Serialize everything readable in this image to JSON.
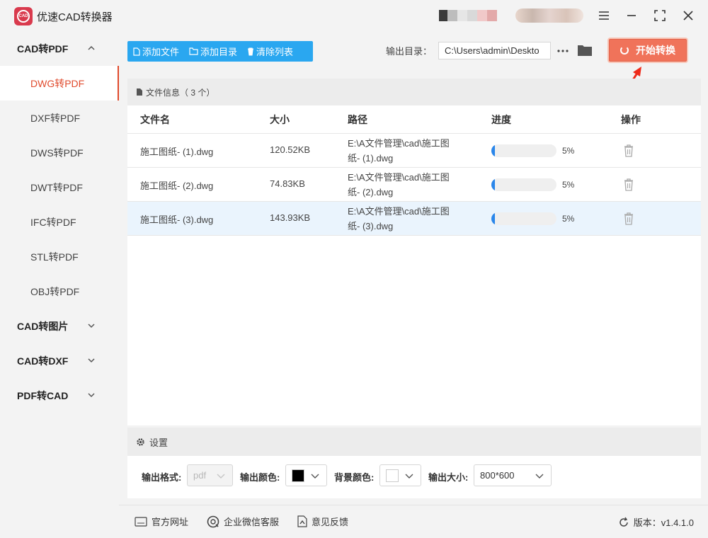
{
  "app": {
    "title": "优速CAD转换器",
    "logo_text": "CAD"
  },
  "sidebar": {
    "groups": [
      {
        "label": "CAD转PDF",
        "expanded": true,
        "items": [
          "DWG转PDF",
          "DXF转PDF",
          "DWS转PDF",
          "DWT转PDF",
          "IFC转PDF",
          "STL转PDF",
          "OBJ转PDF"
        ],
        "active_item": "DWG转PDF"
      },
      {
        "label": "CAD转图片",
        "expanded": false
      },
      {
        "label": "CAD转DXF",
        "expanded": false
      },
      {
        "label": "PDF转CAD",
        "expanded": false
      }
    ]
  },
  "toolbar": {
    "add_file": "添加文件",
    "add_dir": "添加目录",
    "clear_list": "清除列表",
    "output_label": "输出目录：",
    "output_path": "C:\\Users\\admin\\Deskto",
    "start": "开始转换"
  },
  "file_panel": {
    "header": "文件信息（ 3 个）",
    "columns": {
      "name": "文件名",
      "size": "大小",
      "path": "路径",
      "progress": "进度",
      "action": "操作"
    },
    "rows": [
      {
        "name": "施工图纸- (1).dwg",
        "size": "120.52KB",
        "path_line1": "E:\\A文件管理\\cad\\施工图",
        "path_line2": "纸- (1).dwg",
        "progress": 0.05,
        "progress_text": "5%"
      },
      {
        "name": "施工图纸- (2).dwg",
        "size": "74.83KB",
        "path_line1": "E:\\A文件管理\\cad\\施工图",
        "path_line2": "纸- (2).dwg",
        "progress": 0.05,
        "progress_text": "5%"
      },
      {
        "name": "施工图纸- (3).dwg",
        "size": "143.93KB",
        "path_line1": "E:\\A文件管理\\cad\\施工图",
        "path_line2": "纸- (3).dwg",
        "progress": 0.05,
        "progress_text": "5%",
        "selected": true
      }
    ]
  },
  "settings": {
    "header": "设置",
    "format_label": "输出格式:",
    "format_value": "pdf",
    "color_label": "输出颜色:",
    "color_value": "#000000",
    "bg_label": "背景颜色:",
    "bg_value": "#ffffff",
    "size_label": "输出大小:",
    "size_value": "800*600"
  },
  "footer": {
    "website": "官方网址",
    "wechat": "企业微信客服",
    "feedback": "意见反馈",
    "version": "版本：v1.4.1.0"
  },
  "colors": {
    "accent": "#e04a2c",
    "primary": "#2aa7f0",
    "start_button": "#f0735a",
    "progress": "#2a86ea"
  }
}
